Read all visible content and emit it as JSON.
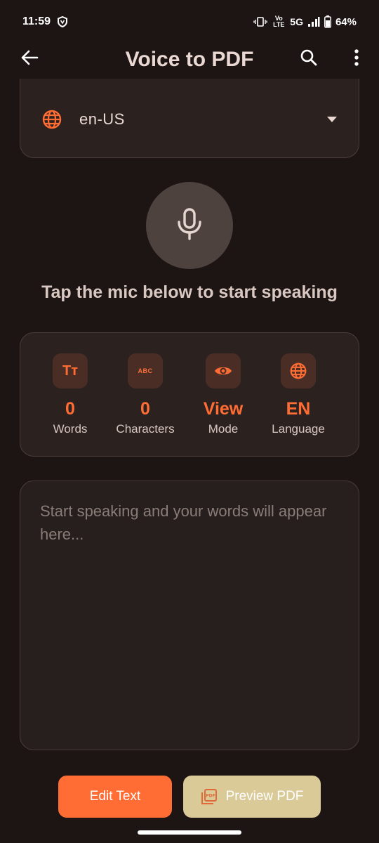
{
  "status_bar": {
    "time": "11:59",
    "network": "5G",
    "volte_label": "Vo LTE",
    "battery_percent": "64%"
  },
  "app_bar": {
    "title": "Voice to PDF",
    "icons": [
      "arrow-back-icon",
      "search-icon",
      "more-vert-icon"
    ]
  },
  "language": {
    "value": "en-US",
    "icon": "globe-icon"
  },
  "mic": {
    "icon": "microphone-icon",
    "hint": "Tap the mic below to start speaking"
  },
  "stats": [
    {
      "icon": "text-size-icon",
      "icon_text": "Tт",
      "value": "0",
      "label": "Words"
    },
    {
      "icon": "abc-icon",
      "icon_text": "ABC",
      "value": "0",
      "label": "Characters"
    },
    {
      "icon": "eye-icon",
      "value": "View",
      "label": "Mode"
    },
    {
      "icon": "globe-icon",
      "value": "EN",
      "label": "Language"
    }
  ],
  "editor": {
    "placeholder": "Start speaking and your words will appear here..."
  },
  "actions": {
    "edit_label": "Edit Text",
    "preview_label": "Preview PDF",
    "preview_icon_text": "PDF"
  },
  "colors": {
    "background": "#1d1513",
    "accent": "#ff6d35",
    "secondary": "#d9ca98",
    "card": "#2b2220"
  }
}
